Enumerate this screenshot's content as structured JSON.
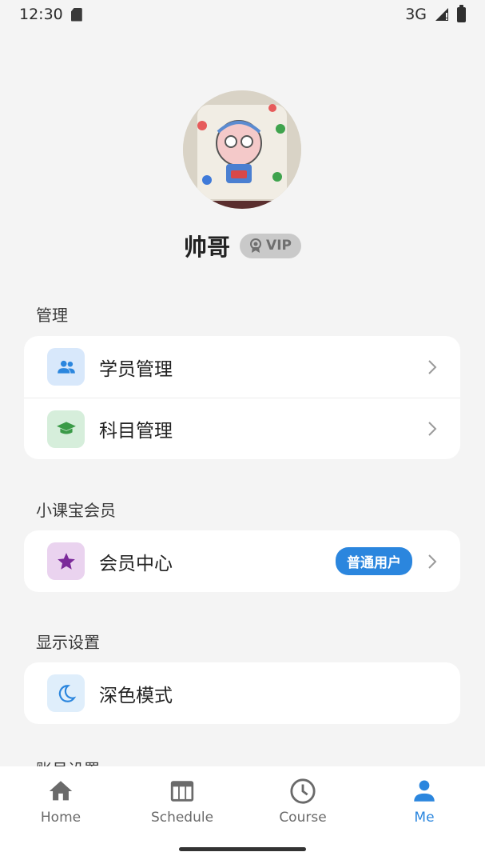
{
  "status_bar": {
    "time": "12:30",
    "network": "3G"
  },
  "profile": {
    "name": "帅哥",
    "vip_label": "VIP"
  },
  "sections": [
    {
      "title": "管理",
      "items": [
        {
          "label": "学员管理",
          "icon": "people-icon",
          "icon_bg": "#d8e8fb",
          "icon_color": "#2b86de"
        },
        {
          "label": "科目管理",
          "icon": "graduation-cap-icon",
          "icon_bg": "#d6eedb",
          "icon_color": "#3a9a47"
        }
      ]
    },
    {
      "title": "小课宝会员",
      "items": [
        {
          "label": "会员中心",
          "icon": "star-icon",
          "icon_bg": "#ead3ef",
          "icon_color": "#7b2a9a",
          "badge": "普通用户"
        }
      ]
    },
    {
      "title": "显示设置",
      "items": [
        {
          "label": "深色模式",
          "icon": "moon-icon",
          "icon_bg": "#dfeefb",
          "icon_color": "#2b86de"
        }
      ]
    },
    {
      "title": "账号设置"
    }
  ],
  "nav": {
    "items": [
      {
        "label": "Home",
        "icon": "home-icon"
      },
      {
        "label": "Schedule",
        "icon": "calendar-icon"
      },
      {
        "label": "Course",
        "icon": "clock-icon"
      },
      {
        "label": "Me",
        "icon": "person-icon",
        "active": true
      }
    ]
  },
  "colors": {
    "accent": "#2b86de",
    "background": "#f4f4f4",
    "card": "#ffffff"
  }
}
